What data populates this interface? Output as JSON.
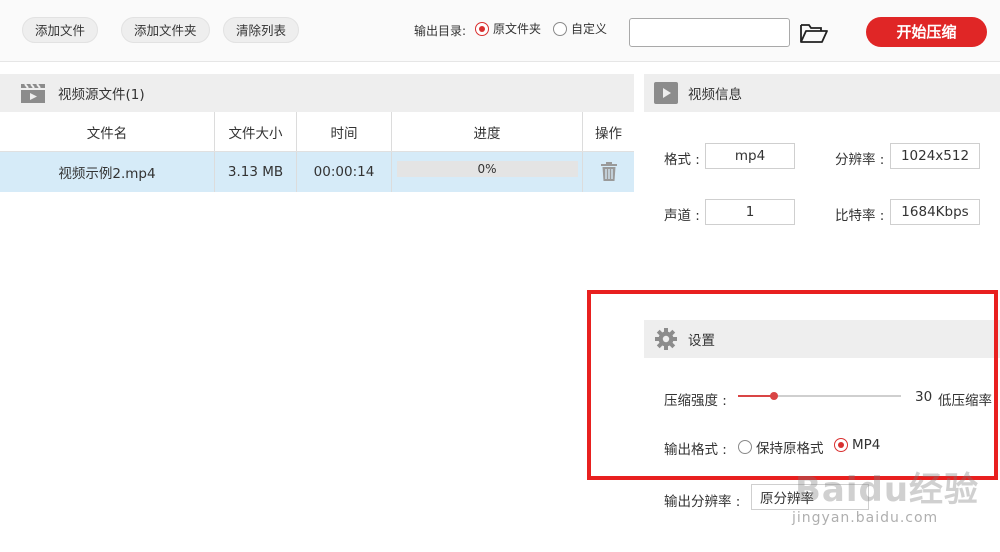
{
  "toolbar": {
    "add_file": "添加文件",
    "add_folder": "添加文件夹",
    "clear_list": "清除列表",
    "output_dir_label": "输出目录:",
    "output_options": [
      "原文件夹",
      "自定义"
    ],
    "output_selected": "原文件夹",
    "path_value": "",
    "start_label": "开始压缩",
    "folder_icon": "folder-open-icon"
  },
  "file_panel": {
    "title": "视频源文件(1)",
    "icon": "clapperboard-icon",
    "columns": [
      "文件名",
      "文件大小",
      "时间",
      "进度",
      "操作"
    ],
    "rows": [
      {
        "name": "视频示例2.mp4",
        "size": "3.13 MB",
        "duration": "00:00:14",
        "progress": "0%",
        "progress_value": 0
      }
    ]
  },
  "video_info": {
    "title": "视频信息",
    "icon": "play-icon",
    "format_label": "格式 :",
    "format_value": "mp4",
    "resolution_label": "分辨率 :",
    "resolution_value": "1024x512",
    "channel_label": "声道 :",
    "channel_value": "1",
    "bitrate_label": "比特率 :",
    "bitrate_value": "1684Kbps"
  },
  "settings": {
    "title": "设置",
    "icon": "gear-icon",
    "strength_label": "压缩强度 :",
    "strength_value": "30",
    "strength_fraction": 0.22,
    "strength_desc": "低压缩率",
    "format_label": "输出格式 :",
    "format_options": [
      "保持原格式",
      "MP4"
    ],
    "format_selected": "MP4",
    "resolution_label": "输出分辨率 :",
    "resolution_value": "原分辨率"
  },
  "watermark": {
    "brand": "Baidu经验",
    "url": "jingyan.baidu.com"
  },
  "colors": {
    "accent": "#e02626",
    "highlight_frame": "#e8201f",
    "selected_row": "#d6ebf8"
  }
}
